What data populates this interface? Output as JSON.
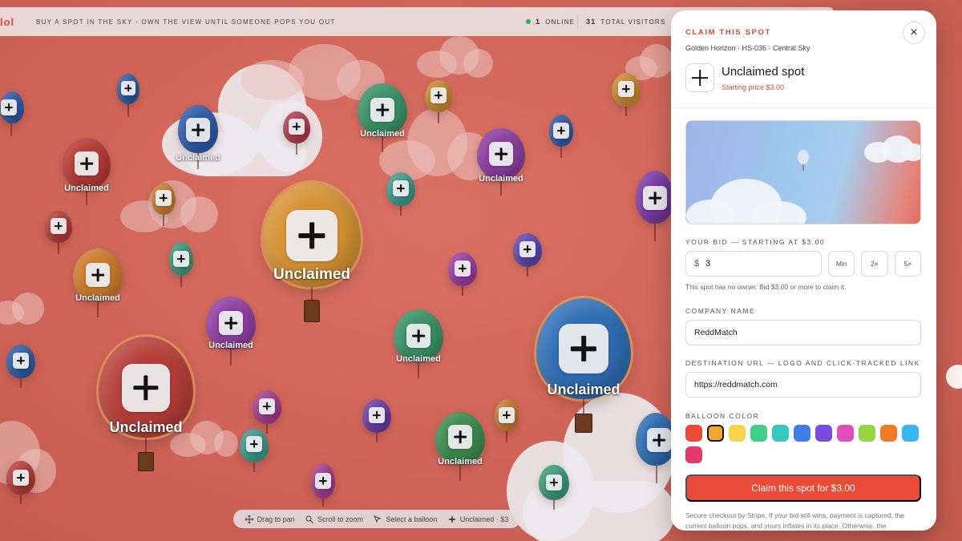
{
  "topbar": {
    "brand": "lol",
    "tagline": "BUY A SPOT IN THE SKY · OWN THE VIEW UNTIL SOMEONE POPS YOU OUT",
    "online_count": "1",
    "online_label": "ONLINE",
    "visitors_count": "31",
    "visitors_label": "TOTAL VISITORS"
  },
  "map": {
    "balloon_label": "Unclaimed"
  },
  "hints": {
    "drag": "Drag to pan",
    "scroll": "Scroll to zoom",
    "select": "Select a balloon",
    "unclaimed": "Unclaimed · $3"
  },
  "panel": {
    "eyebrow": "CLAIM THIS SPOT",
    "location": "Golden Horizon · HS-036 · Central Sky",
    "close_label": "×",
    "spot_title": "Unclaimed spot",
    "spot_price": "Starting price $3.00",
    "bid_label": "YOUR BID — STARTING AT $3.00",
    "bid_currency": "$",
    "bid_value": "3",
    "bid_chips": [
      "Min",
      "2×",
      "5×"
    ],
    "bid_help": "This spot has no owner. Bid $3.00 or more to claim it.",
    "company_label": "COMPANY NAME",
    "company_value": "ReddMatch",
    "url_label": "DESTINATION URL — LOGO AND CLICK-TRACKED LINK",
    "url_value": "https://reddmatch.com",
    "color_label": "BALLOON COLOR",
    "colors": [
      "#ea4a37",
      "#f0a632",
      "#f7d54a",
      "#3fcf8a",
      "#36c7bf",
      "#3f7ee8",
      "#7a4be0",
      "#e04fb9",
      "#93d63f",
      "#f27b26",
      "#3ab5f0",
      "#e33a6e"
    ],
    "selected_color": "#f0a632",
    "cta_label": "Claim this spot for $3.00",
    "footnote": "Secure checkout by Stripe. If your bid still wins, payment is captured, the current balloon pops, and yours inflates in its place. Otherwise, the"
  }
}
